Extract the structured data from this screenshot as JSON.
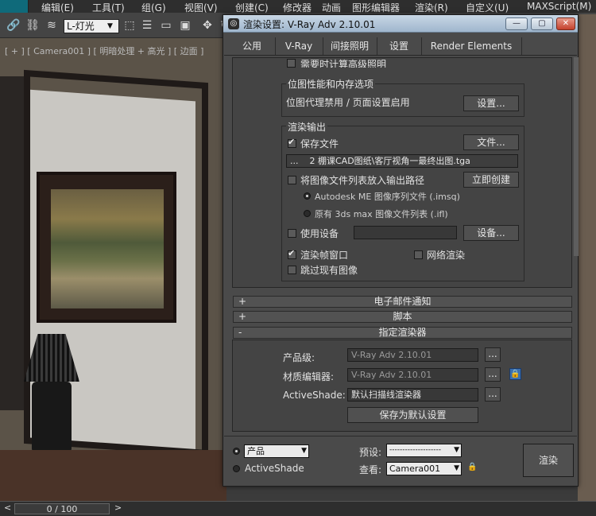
{
  "app": {
    "menus": [
      "编辑(E)",
      "工具(T)",
      "组(G)",
      "视图(V)",
      "创建(C)",
      "修改器",
      "动画",
      "图形编辑器",
      "渲染(R)",
      "自定义(U)",
      "MAXScript(M)"
    ],
    "light_selector": "L-灯光",
    "viewport_label": "[ + ] [ Camera001 ] [ 明暗处理 + 高光 ] [ 边面 ]",
    "time_slider": "0 / 100",
    "time_prev": "<",
    "time_next": ">"
  },
  "dialog": {
    "title": "渲染设置: V-Ray Adv 2.10.01",
    "min": "—",
    "max": "▢",
    "close": "✕",
    "tabs": [
      "公用",
      "V-Ray",
      "间接照明",
      "设置",
      "Render Elements"
    ],
    "cut_option": "需要时计算高级照明",
    "bitmap": {
      "title": "位图性能和内存选项",
      "text": "位图代理禁用 / 页面设置启用",
      "button": "设置..."
    },
    "output": {
      "title": "渲染输出",
      "save_file": "保存文件",
      "file_button": "文件...",
      "path_button": "...",
      "path": "2 棚课CAD图纸\\客厅视角一最终出图.tga",
      "put_list": "将图像文件列表放入输出路径",
      "create_now": "立即创建",
      "radio1": "Autodesk ME 图像序列文件 (.imsq)",
      "radio2": "原有 3ds max 图像文件列表 (.ifl)",
      "use_device": "使用设备",
      "device_button": "设备...",
      "render_frame": "渲染帧窗口",
      "net_render": "网络渲染",
      "skip_existing": "跳过现有图像"
    },
    "rollouts": {
      "email": {
        "sign": "+",
        "title": "电子邮件通知"
      },
      "script": {
        "sign": "+",
        "title": "脚本"
      },
      "assign": {
        "sign": "-",
        "title": "指定渲染器"
      }
    },
    "assign": {
      "production_label": "产品级:",
      "production_value": "V-Ray Adv 2.10.01",
      "material_label": "材质编辑器:",
      "material_value": "V-Ray Adv 2.10.01",
      "activeshade_label": "ActiveShade:",
      "activeshade_value": "默认扫描线渲染器",
      "browse": "...",
      "save_default": "保存为默认设置"
    },
    "bottom": {
      "mode_production": "产品",
      "mode_activeshade": "ActiveShade",
      "preset_label": "预设:",
      "preset_value": "--------------------",
      "view_label": "查看:",
      "view_value": "Camera001",
      "render_button": "渲染"
    }
  }
}
